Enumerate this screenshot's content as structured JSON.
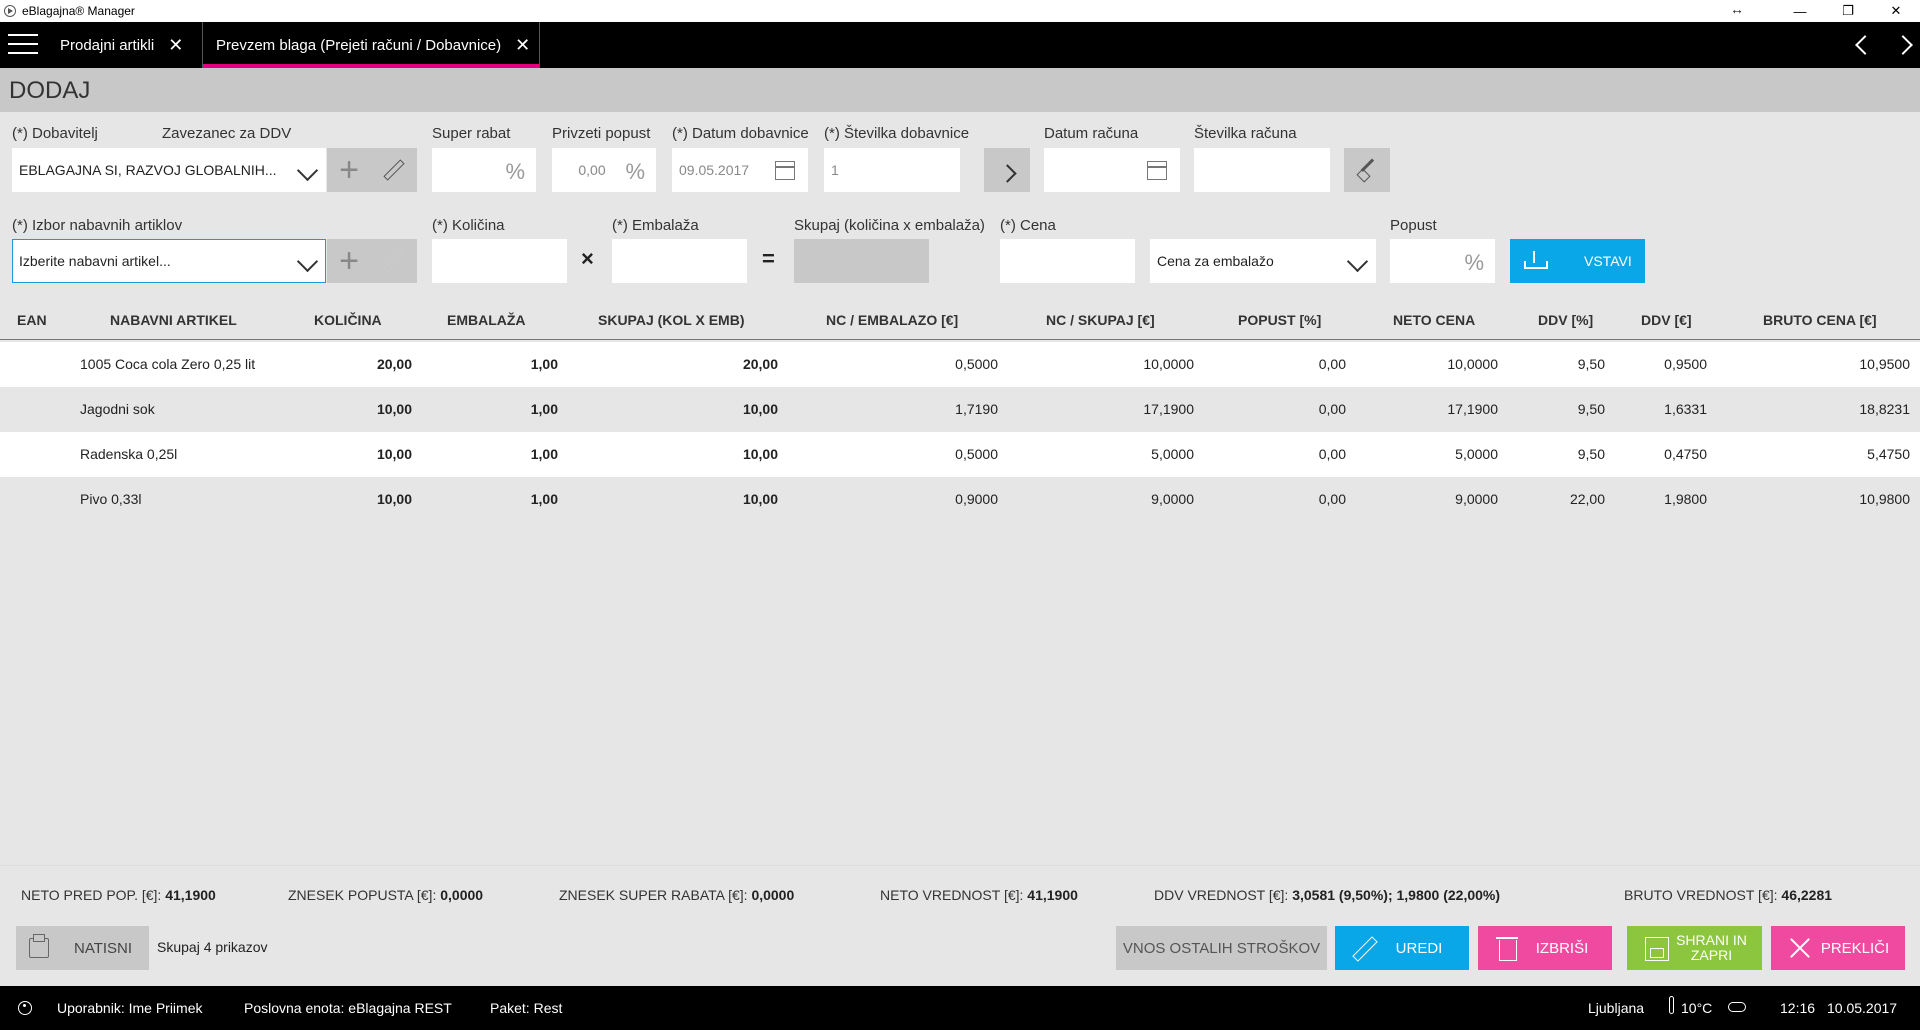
{
  "window": {
    "title": "eBlagajna® Manager",
    "controls": [
      "↔",
      "—",
      "❐",
      "✕"
    ]
  },
  "tabs": [
    {
      "label": "Prodajni artikli",
      "close": "✕"
    },
    {
      "label": "Prevzem blaga (Prejeti računi / Dobavnice)",
      "close": "✕"
    }
  ],
  "page": {
    "title": "DODAJ"
  },
  "form": {
    "dobavitelj_label": "(*) Dobavitelj",
    "zavezanec_label": "Zavezanec za DDV",
    "dobavitelj_value": "EBLAGAJNA SI, RAZVOJ GLOBALNIH...",
    "super_rabat_label": "Super rabat",
    "privzeti_popust_label": "Privzeti popust",
    "privzeti_popust_value": "0,00",
    "datum_dobavnice_label": "(*) Datum dobavnice",
    "datum_dobavnice_value": "09.05.2017",
    "stevilka_dobavnice_label": "(*) Številka dobavnice",
    "stevilka_dobavnice_value": "1",
    "datum_racuna_label": "Datum računa",
    "stevilka_racuna_label": "Številka računa",
    "izbor_label": "(*) Izbor nabavnih artiklov",
    "izbor_placeholder": "Izberite nabavni artikel...",
    "kolicina_label": "(*) Količina",
    "embalaza_label": "(*) Embalaža",
    "skupaj_label": "Skupaj (količina x embalaža)",
    "cena_label": "(*) Cena",
    "cena_tip_value": "Cena za embalažo",
    "popust_label": "Popust",
    "percent_symbol": "%",
    "times_symbol": "×",
    "equals_symbol": "=",
    "vstavi_label": "VSTAVI"
  },
  "table": {
    "headers": [
      "EAN",
      "NABAVNI ARTIKEL",
      "KOLIČINA",
      "EMBALAŽA",
      "SKUPAJ (KOL X EMB)",
      "NC / EMBALAZO [€]",
      "NC / SKUPAJ [€]",
      "POPUST [%]",
      "NETO CENA",
      "DDV [%]",
      "DDV [€]",
      "BRUTO CENA [€]"
    ],
    "rows": [
      {
        "ean": "",
        "artikel": "1005 Coca cola Zero 0,25 lit",
        "kolicina": "20,00",
        "embalaza": "1,00",
        "skupaj": "20,00",
        "nc_emb": "0,5000",
        "nc_skupaj": "10,0000",
        "popust": "0,00",
        "neto": "10,0000",
        "ddv_pct": "9,50",
        "ddv_eur": "0,9500",
        "bruto": "10,9500"
      },
      {
        "ean": "",
        "artikel": "Jagodni sok",
        "kolicina": "10,00",
        "embalaza": "1,00",
        "skupaj": "10,00",
        "nc_emb": "1,7190",
        "nc_skupaj": "17,1900",
        "popust": "0,00",
        "neto": "17,1900",
        "ddv_pct": "9,50",
        "ddv_eur": "1,6331",
        "bruto": "18,8231"
      },
      {
        "ean": "",
        "artikel": "Radenska 0,25l",
        "kolicina": "10,00",
        "embalaza": "1,00",
        "skupaj": "10,00",
        "nc_emb": "0,5000",
        "nc_skupaj": "5,0000",
        "popust": "0,00",
        "neto": "5,0000",
        "ddv_pct": "9,50",
        "ddv_eur": "0,4750",
        "bruto": "5,4750"
      },
      {
        "ean": "",
        "artikel": "Pivo 0,33l",
        "kolicina": "10,00",
        "embalaza": "1,00",
        "skupaj": "10,00",
        "nc_emb": "0,9000",
        "nc_skupaj": "9,0000",
        "popust": "0,00",
        "neto": "9,0000",
        "ddv_pct": "22,00",
        "ddv_eur": "1,9800",
        "bruto": "10,9800"
      }
    ]
  },
  "summary": {
    "neto_pred_pop_label": "NETO PRED POP. [€]:",
    "neto_pred_pop_value": "41,1900",
    "znesek_popusta_label": "ZNESEK POPUSTA [€]:",
    "znesek_popusta_value": "0,0000",
    "znesek_super_rabata_label": "ZNESEK SUPER RABATA [€]:",
    "znesek_super_rabata_value": "0,0000",
    "neto_vrednost_label": "NETO VREDNOST [€]:",
    "neto_vrednost_value": "41,1900",
    "ddv_vrednost_label": "DDV VREDNOST [€]:",
    "ddv_vrednost_value": "3,0581 (9,50%); 1,9800 (22,00%)",
    "bruto_vrednost_label": "BRUTO VREDNOST [€]:",
    "bruto_vrednost_value": "46,2281"
  },
  "actions": {
    "natisni": "NATISNI",
    "count": "Skupaj 4 prikazov",
    "vnos": "VNOS OSTALIH STROŠKOV",
    "uredi": "UREDI",
    "izbrisi": "IZBRIŠI",
    "shrani_line1": "SHRANI IN",
    "shrani_line2": "ZAPRI",
    "preklici": "PREKLIČI"
  },
  "status": {
    "uporabnik": "Uporabnik: Ime Priimek",
    "poslovna_enota": "Poslovna enota: eBlagajna REST",
    "paket": "Paket: Rest",
    "city": "Ljubljana",
    "temperature": "10°C",
    "time": "12:16",
    "date": "10.05.2017"
  },
  "colors": {
    "accent_blue": "#09a6e8",
    "accent_pink": "#ef4aa0",
    "accent_green": "#8cc63f",
    "tab_underline": "#e5007e"
  }
}
